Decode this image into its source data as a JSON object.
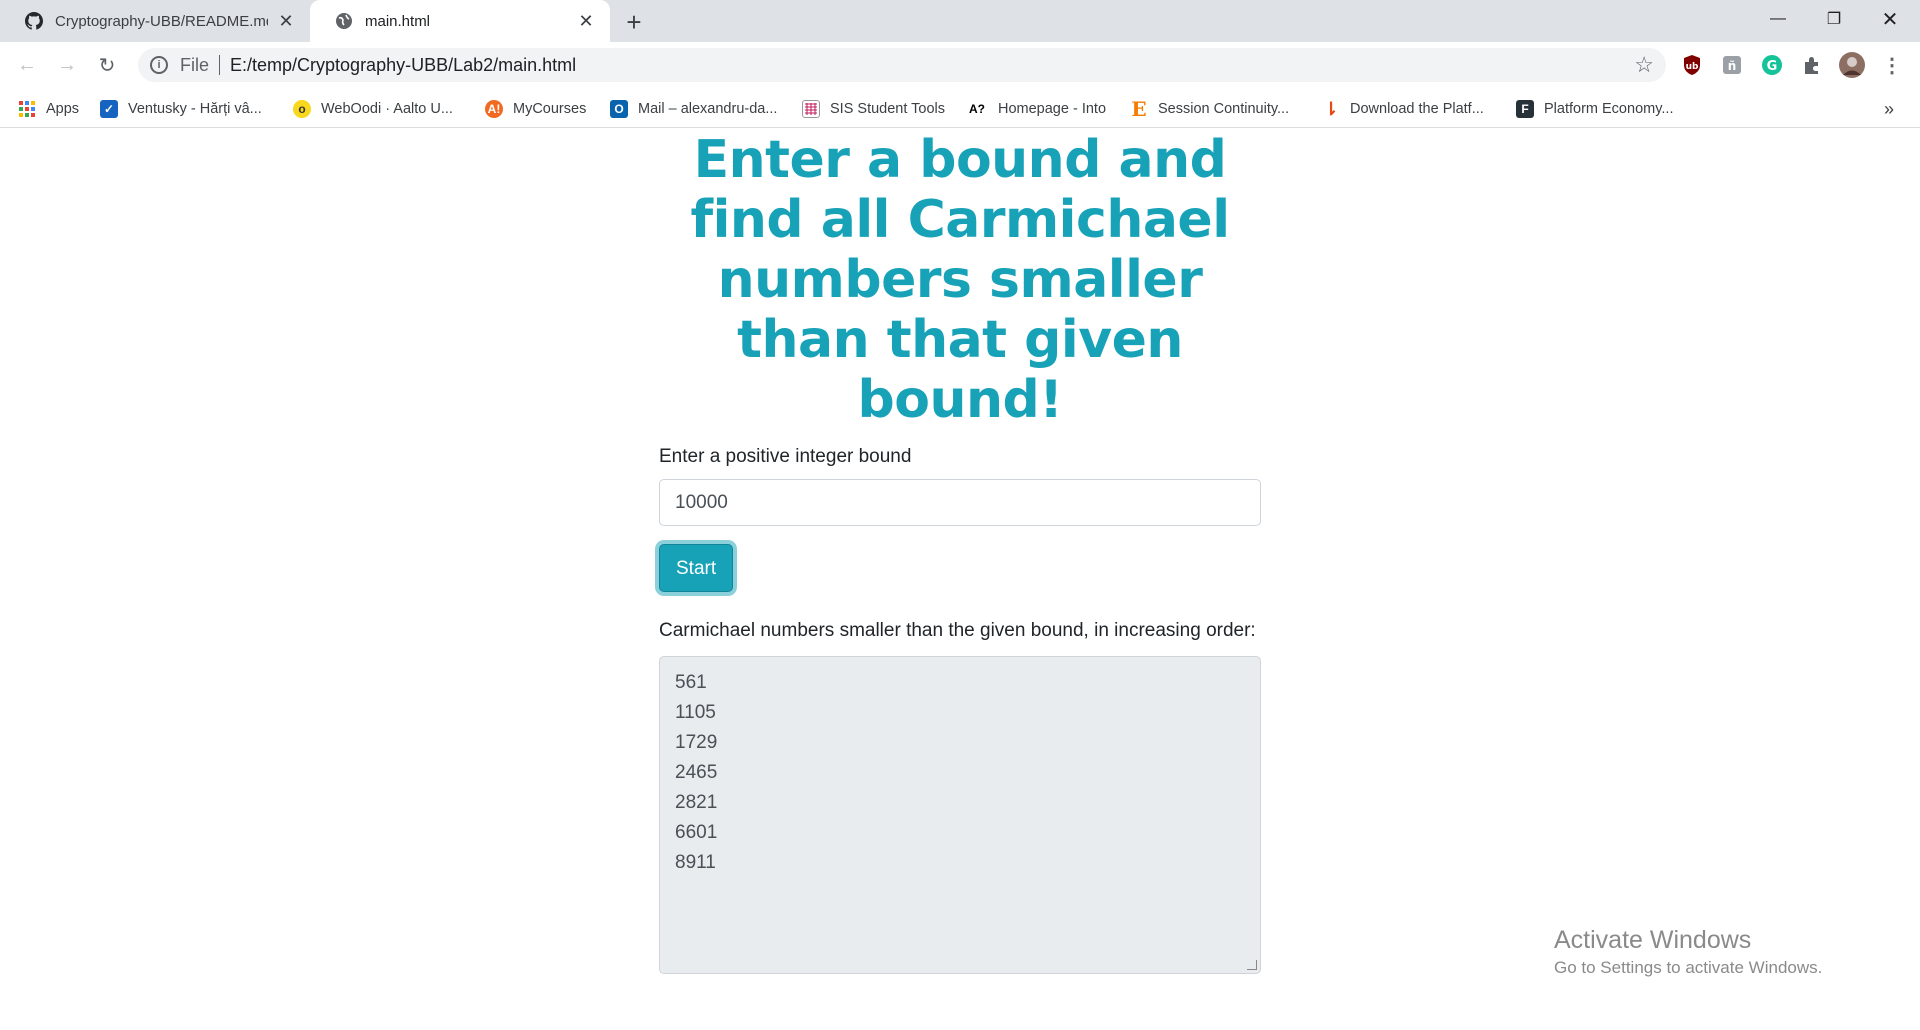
{
  "browser": {
    "tabs": [
      {
        "title": "Cryptography-UBB/README.md",
        "icon": "github-icon",
        "active": false
      },
      {
        "title": "main.html",
        "icon": "globe-icon",
        "active": true
      }
    ],
    "address": {
      "scheme": "File",
      "url": "E:/temp/Cryptography-UBB/Lab2/main.html"
    },
    "bookmarks": [
      {
        "label": "Apps",
        "icon": "apps-grid-icon"
      },
      {
        "label": "Ventusky - Hărți vâ...",
        "icon": "ventusky-icon"
      },
      {
        "label": "WebOodi · Aalto U...",
        "icon": "weboodi-icon"
      },
      {
        "label": "MyCourses",
        "icon": "aalto-icon"
      },
      {
        "label": "Mail – alexandru-da...",
        "icon": "outlook-icon"
      },
      {
        "label": "SIS Student Tools",
        "icon": "sis-icon"
      },
      {
        "label": "Homepage - Into",
        "icon": "into-icon"
      },
      {
        "label": "Session Continuity...",
        "icon": "e-icon"
      },
      {
        "label": "Download the Platf...",
        "icon": "platform-icon"
      },
      {
        "label": "Platform Economy...",
        "icon": "f-icon"
      }
    ],
    "bookmarks_overflow": "»"
  },
  "page": {
    "heading": "Enter a bound and find all Carmichael numbers smaller than that given bound!",
    "input_label": "Enter a positive integer bound",
    "input_value": "10000",
    "start_label": "Start",
    "result_label": "Carmichael numbers smaller than the given bound, in increasing order:",
    "results": [
      "561",
      "1105",
      "1729",
      "2465",
      "2821",
      "6601",
      "8911"
    ]
  },
  "watermark": {
    "line1": "Activate Windows",
    "line2": "Go to Settings to activate Windows."
  },
  "colors": {
    "accent": "#17a2b8",
    "readonly_bg": "#e9ecef"
  }
}
